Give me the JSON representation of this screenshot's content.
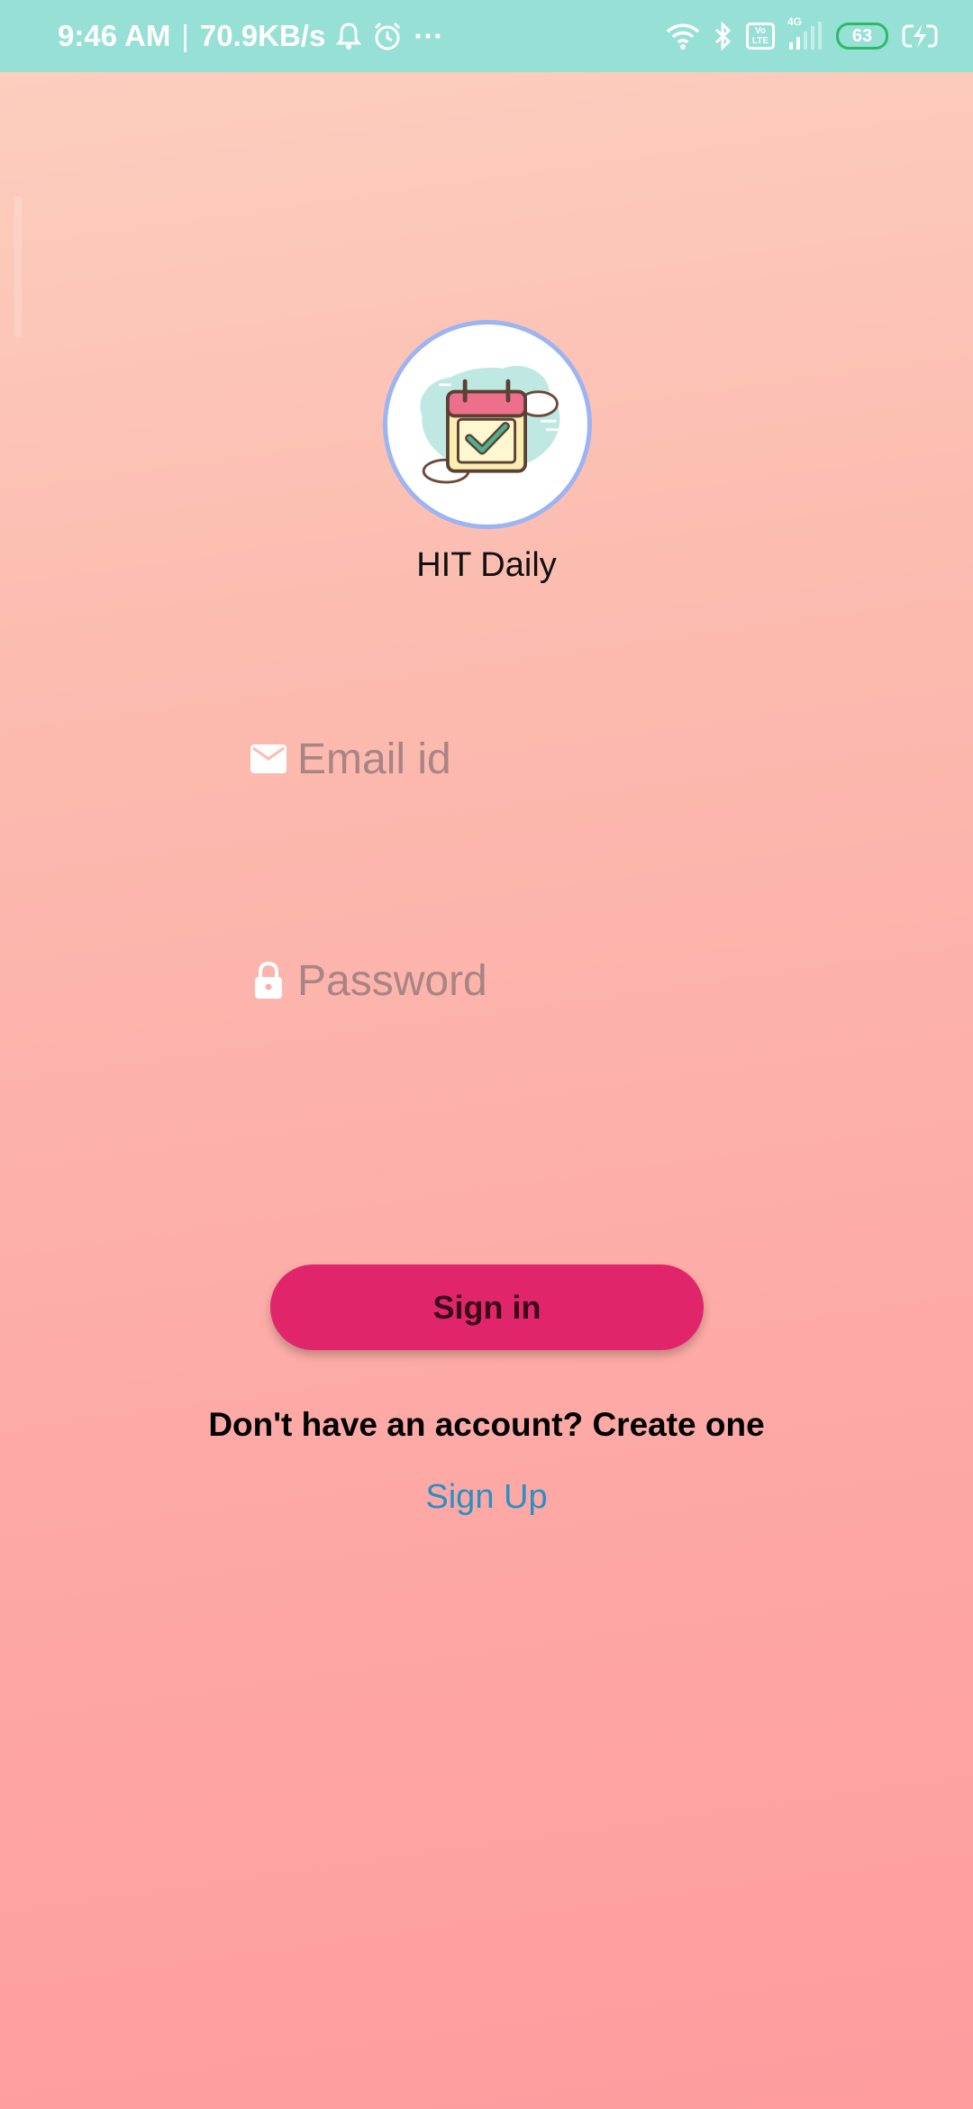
{
  "status_bar": {
    "time": "9:46 AM",
    "separator": "|",
    "speed": "70.9KB/s",
    "more": "···",
    "volte_line1": "Vo",
    "volte_line2": "LTE",
    "network": "4G",
    "battery": "63",
    "icons": [
      "notification-bell-icon",
      "alarm-icon",
      "wifi-icon",
      "bluetooth-icon",
      "signal-icon",
      "charging-icon"
    ]
  },
  "app": {
    "name": "HIT Daily",
    "logo_icon": "calendar-check-icon"
  },
  "form": {
    "email_placeholder": "Email id",
    "email_icon": "mail-icon",
    "password_placeholder": "Password",
    "password_icon": "lock-icon",
    "signin_label": "Sign in",
    "account_prompt": "Don't have an account? Create one",
    "signup_label": "Sign Up"
  },
  "colors": {
    "status_bar": "#96e0d6",
    "button": "#e0256b",
    "link": "#2a8fc4",
    "logo_ring": "#9cb4f2"
  }
}
